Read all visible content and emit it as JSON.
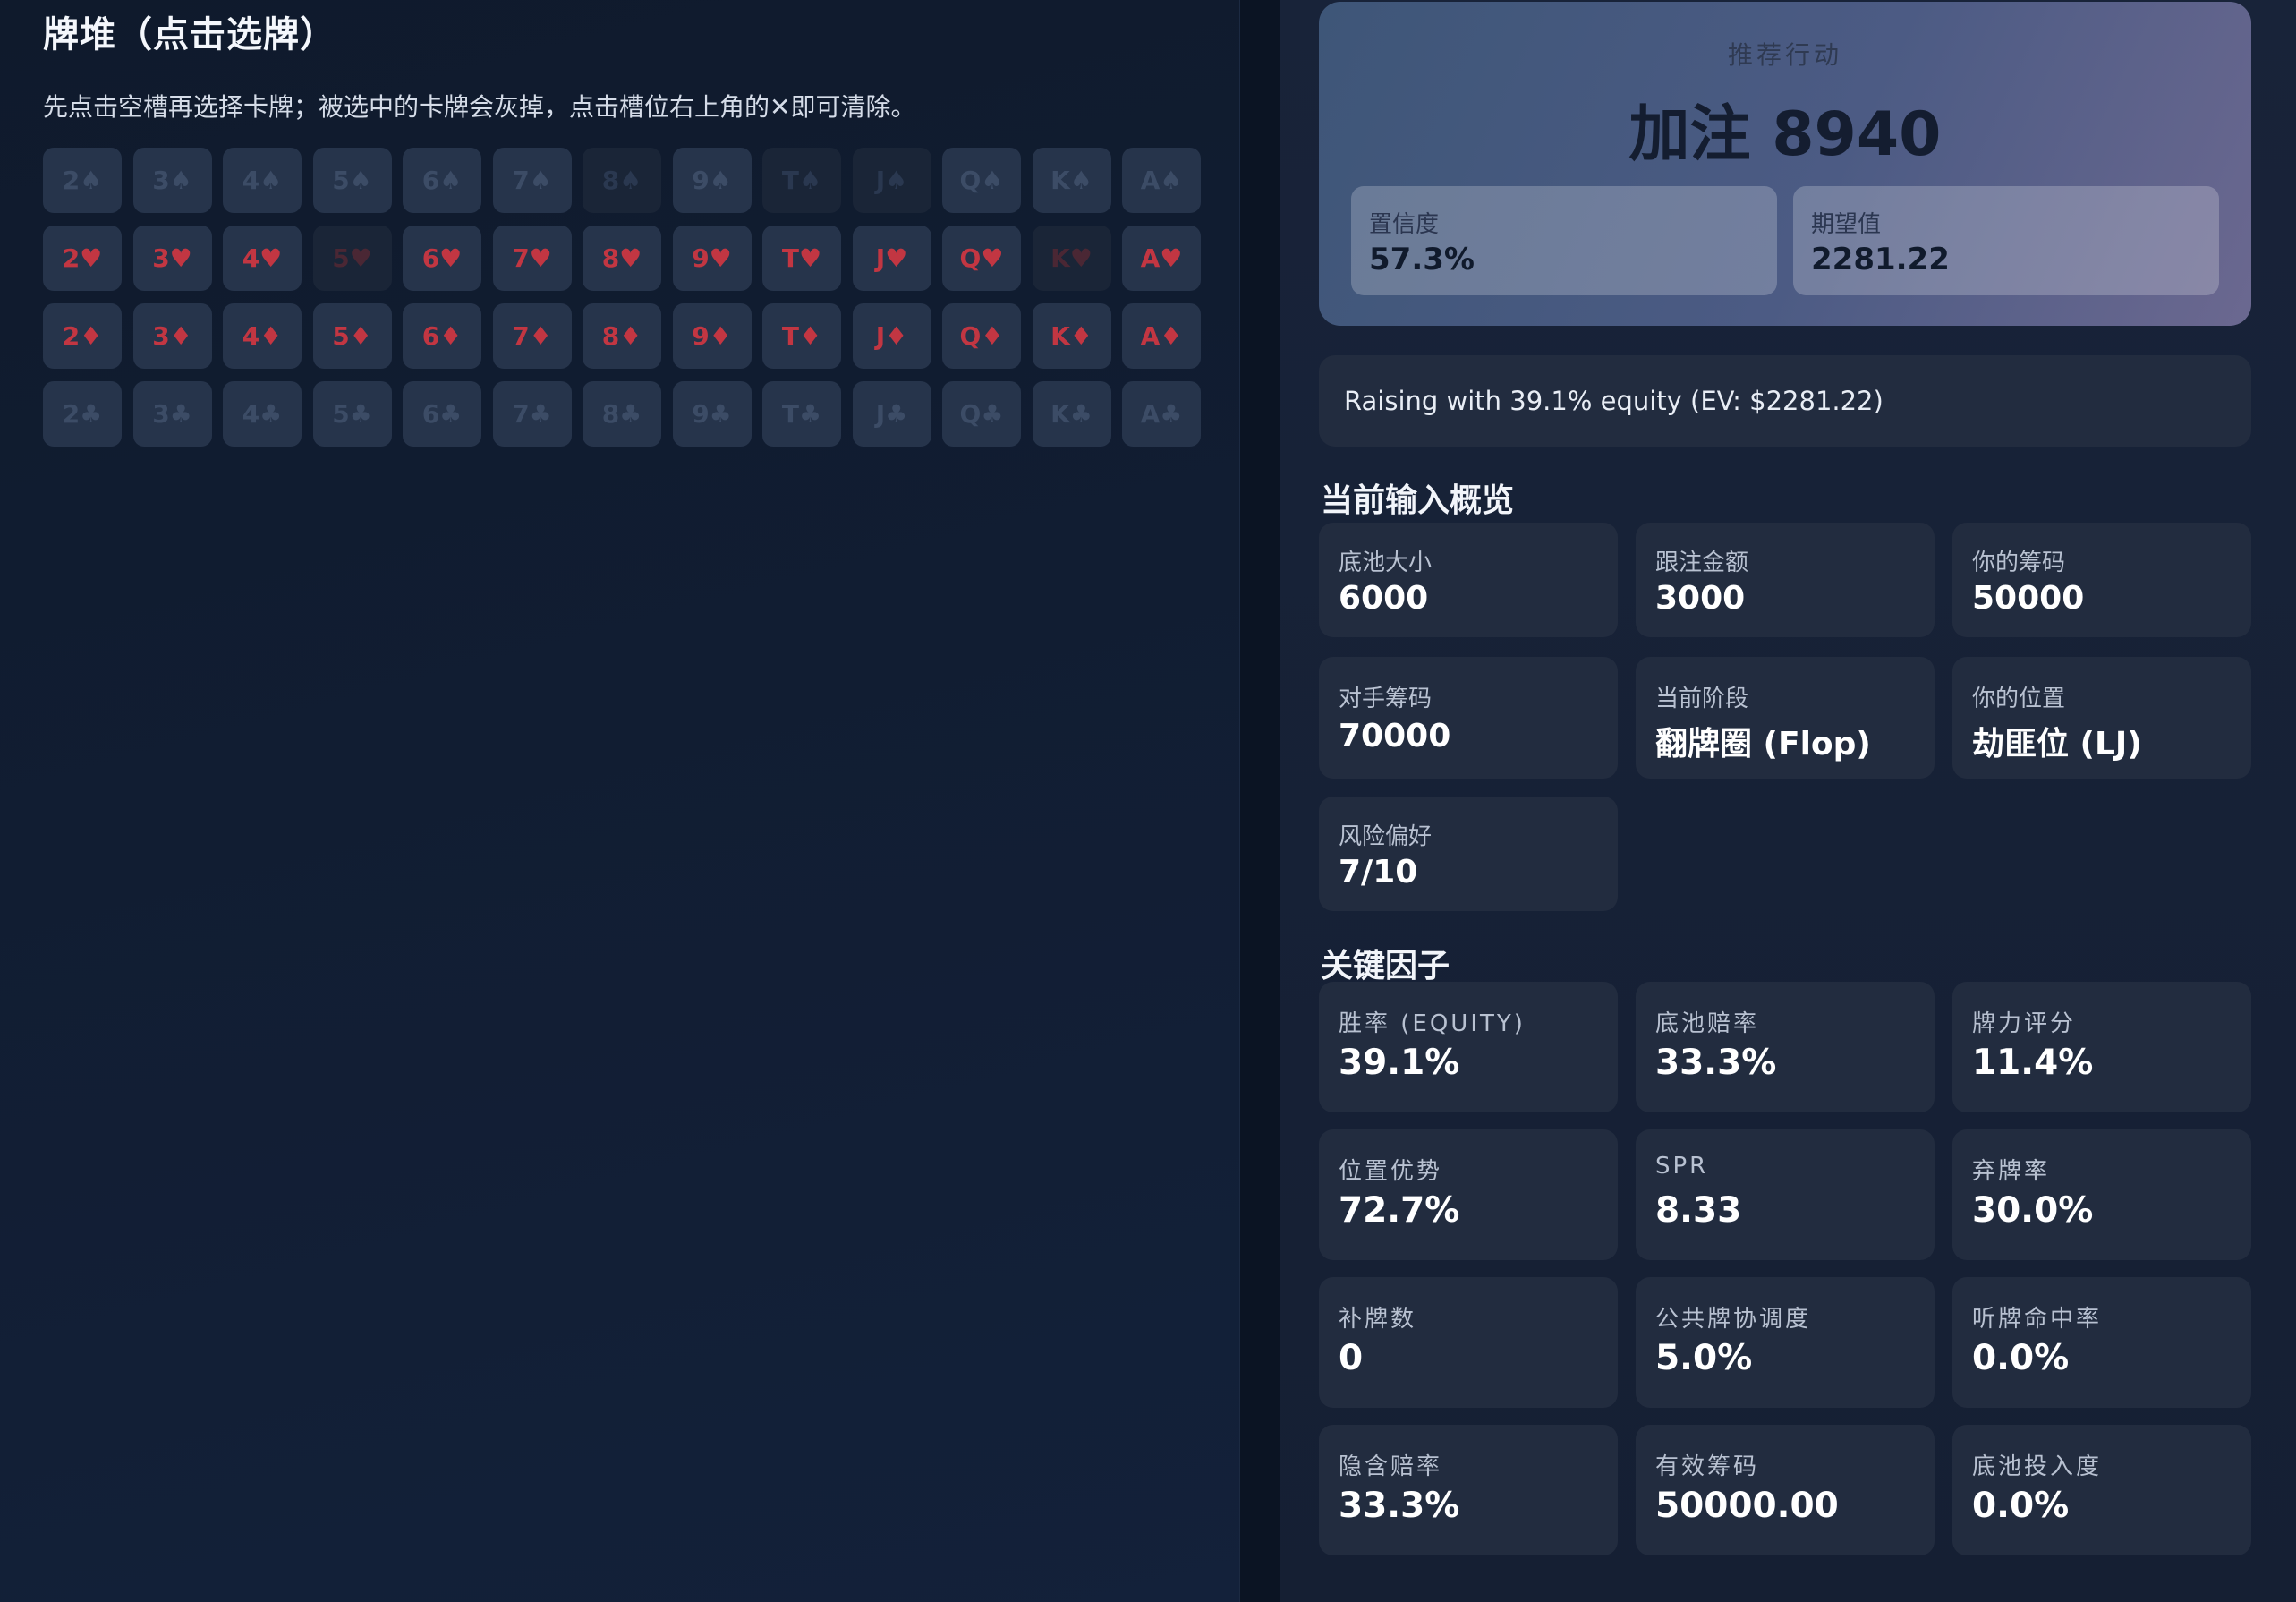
{
  "deck": {
    "title": "牌堆（点击选牌）",
    "hint": "先点击空槽再选择卡牌；被选中的卡牌会灰掉，点击槽位右上角的✕即可清除。",
    "rows": [
      {
        "suit": "spades",
        "color": "dark",
        "cards": [
          {
            "label": "2♠",
            "used": false
          },
          {
            "label": "3♠",
            "used": false
          },
          {
            "label": "4♠",
            "used": false
          },
          {
            "label": "5♠",
            "used": false
          },
          {
            "label": "6♠",
            "used": false
          },
          {
            "label": "7♠",
            "used": false
          },
          {
            "label": "8♠",
            "used": true
          },
          {
            "label": "9♠",
            "used": false
          },
          {
            "label": "T♠",
            "used": true
          },
          {
            "label": "J♠",
            "used": true
          },
          {
            "label": "Q♠",
            "used": false
          },
          {
            "label": "K♠",
            "used": false
          },
          {
            "label": "A♠",
            "used": false
          }
        ]
      },
      {
        "suit": "hearts",
        "color": "red",
        "cards": [
          {
            "label": "2♥",
            "used": false
          },
          {
            "label": "3♥",
            "used": false
          },
          {
            "label": "4♥",
            "used": false
          },
          {
            "label": "5♥",
            "used": true
          },
          {
            "label": "6♥",
            "used": false
          },
          {
            "label": "7♥",
            "used": false
          },
          {
            "label": "8♥",
            "used": false
          },
          {
            "label": "9♥",
            "used": false
          },
          {
            "label": "T♥",
            "used": false
          },
          {
            "label": "J♥",
            "used": false
          },
          {
            "label": "Q♥",
            "used": false
          },
          {
            "label": "K♥",
            "used": true
          },
          {
            "label": "A♥",
            "used": false
          }
        ]
      },
      {
        "suit": "diamonds",
        "color": "red",
        "cards": [
          {
            "label": "2♦",
            "used": false
          },
          {
            "label": "3♦",
            "used": false
          },
          {
            "label": "4♦",
            "used": false
          },
          {
            "label": "5♦",
            "used": false
          },
          {
            "label": "6♦",
            "used": false
          },
          {
            "label": "7♦",
            "used": false
          },
          {
            "label": "8♦",
            "used": false
          },
          {
            "label": "9♦",
            "used": false
          },
          {
            "label": "T♦",
            "used": false
          },
          {
            "label": "J♦",
            "used": false
          },
          {
            "label": "Q♦",
            "used": false
          },
          {
            "label": "K♦",
            "used": false
          },
          {
            "label": "A♦",
            "used": false
          }
        ]
      },
      {
        "suit": "clubs",
        "color": "dark",
        "cards": [
          {
            "label": "2♣",
            "used": false
          },
          {
            "label": "3♣",
            "used": false
          },
          {
            "label": "4♣",
            "used": false
          },
          {
            "label": "5♣",
            "used": false
          },
          {
            "label": "6♣",
            "used": false
          },
          {
            "label": "7♣",
            "used": false
          },
          {
            "label": "8♣",
            "used": false
          },
          {
            "label": "9♣",
            "used": false
          },
          {
            "label": "T♣",
            "used": false
          },
          {
            "label": "J♣",
            "used": false
          },
          {
            "label": "Q♣",
            "used": false
          },
          {
            "label": "K♣",
            "used": false
          },
          {
            "label": "A♣",
            "used": false
          }
        ]
      }
    ]
  },
  "recommendation": {
    "label": "推荐行动",
    "action": "加注 8940",
    "confidence": {
      "label": "置信度",
      "value": "57.3%"
    },
    "expected_value": {
      "label": "期望值",
      "value": "2281.22"
    },
    "reason": "Raising with 39.1% equity (EV: $2281.22)"
  },
  "overview": {
    "title": "当前输入概览",
    "items": [
      {
        "label": "底池大小",
        "value": "6000"
      },
      {
        "label": "跟注金额",
        "value": "3000"
      },
      {
        "label": "你的筹码",
        "value": "50000"
      },
      {
        "label": "对手筹码",
        "value": "70000"
      },
      {
        "label": "当前阶段",
        "value": "翻牌圈 (Flop)"
      },
      {
        "label": "你的位置",
        "value": "劫匪位 (LJ)"
      },
      {
        "label": "风险偏好",
        "value": "7/10"
      }
    ]
  },
  "factors": {
    "title": "关键因子",
    "items": [
      {
        "label": "胜率 (EQUITY)",
        "value": "39.1%"
      },
      {
        "label": "底池赔率",
        "value": "33.3%"
      },
      {
        "label": "牌力评分",
        "value": "11.4%"
      },
      {
        "label": "位置优势",
        "value": "72.7%"
      },
      {
        "label": "SPR",
        "value": "8.33"
      },
      {
        "label": "弃牌率",
        "value": "30.0%"
      },
      {
        "label": "补牌数",
        "value": "0"
      },
      {
        "label": "公共牌协调度",
        "value": "5.0%"
      },
      {
        "label": "听牌命中率",
        "value": "0.0%"
      },
      {
        "label": "隐含赔率",
        "value": "33.3%"
      },
      {
        "label": "有效筹码",
        "value": "50000.00"
      },
      {
        "label": "底池投入度",
        "value": "0.0%"
      }
    ]
  }
}
